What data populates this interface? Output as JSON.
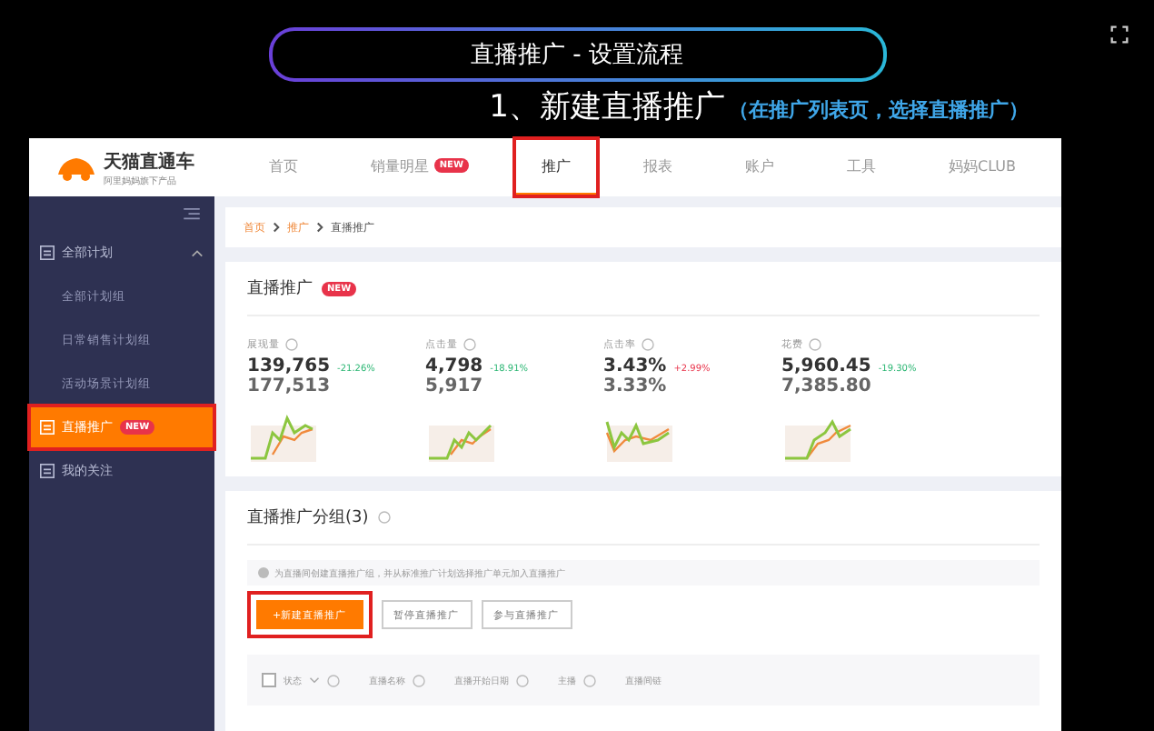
{
  "slide": {
    "title": "直播推广 - 设置流程",
    "step": "1、新建直播推广",
    "step_note": "（在推广列表页，选择直播推广）"
  },
  "app": {
    "logo_name": "天猫直通车",
    "logo_tagline": "阿里妈妈旗下产品",
    "nav": [
      {
        "label": "首页",
        "selected": false,
        "highlighted": false
      },
      {
        "label": "销量明星",
        "selected": false,
        "highlighted": false,
        "badge": "NEW"
      },
      {
        "label": "推广",
        "selected": true,
        "highlighted": true
      },
      {
        "label": "报表",
        "selected": false,
        "highlighted": false
      },
      {
        "label": "账户",
        "selected": false,
        "highlighted": false
      },
      {
        "label": "工具",
        "selected": false,
        "highlighted": false
      },
      {
        "label": "妈妈CLUB",
        "selected": false,
        "highlighted": false
      }
    ],
    "sidebar": [
      {
        "kind": "group",
        "label": "全部计划",
        "expanded": true,
        "selected": false,
        "highlighted": false,
        "children": [
          {
            "label": "全部计划组",
            "selected": false
          },
          {
            "label": "日常销售计划组",
            "selected": false
          },
          {
            "label": "活动场景计划组",
            "selected": false
          }
        ]
      },
      {
        "kind": "item",
        "label": "直播推广",
        "badge": "NEW",
        "selected": true,
        "highlighted": true
      },
      {
        "kind": "item",
        "label": "我的关注",
        "selected": false,
        "highlighted": false
      }
    ],
    "breadcrumb": [
      "首页",
      "推广",
      "直播推广"
    ],
    "overview": {
      "title": "直播推广",
      "badge": "NEW",
      "metrics": [
        {
          "label": "展现量",
          "value": "139,765",
          "change": "-21.26%",
          "color": "#2bb673",
          "previous": "177,513"
        },
        {
          "label": "点击量",
          "value": "4,798",
          "change": "-18.91%",
          "color": "#2bb673",
          "previous": "5,917"
        },
        {
          "label": "点击率",
          "value": "3.43%",
          "change": "+2.99%",
          "color": "#e8334a",
          "previous": "3.33%"
        },
        {
          "label": "花费",
          "value": "5,960.45",
          "change": "-19.30%",
          "color": "#2bb673",
          "previous": "7,385.80"
        }
      ]
    },
    "groups": {
      "title": "直播推广分组(3)",
      "notice": "为直播间创建直播推广组，并从标准推广计划选择推广单元加入直播推广",
      "buttons": [
        {
          "kind": "primary",
          "label": "+新建直播推广",
          "highlighted": true
        },
        {
          "kind": "default",
          "label": "暂停直播推广",
          "highlighted": false
        },
        {
          "kind": "default",
          "label": "参与直播推广",
          "highlighted": false
        }
      ],
      "columns": [
        {
          "label": "状态",
          "kind": "select",
          "checked": false
        },
        {
          "label": "直播名称",
          "kind": "help"
        },
        {
          "label": "直播开始日期",
          "kind": "help"
        },
        {
          "label": "主播",
          "kind": "help"
        },
        {
          "label": "直播间链",
          "kind": "plain"
        }
      ]
    }
  }
}
